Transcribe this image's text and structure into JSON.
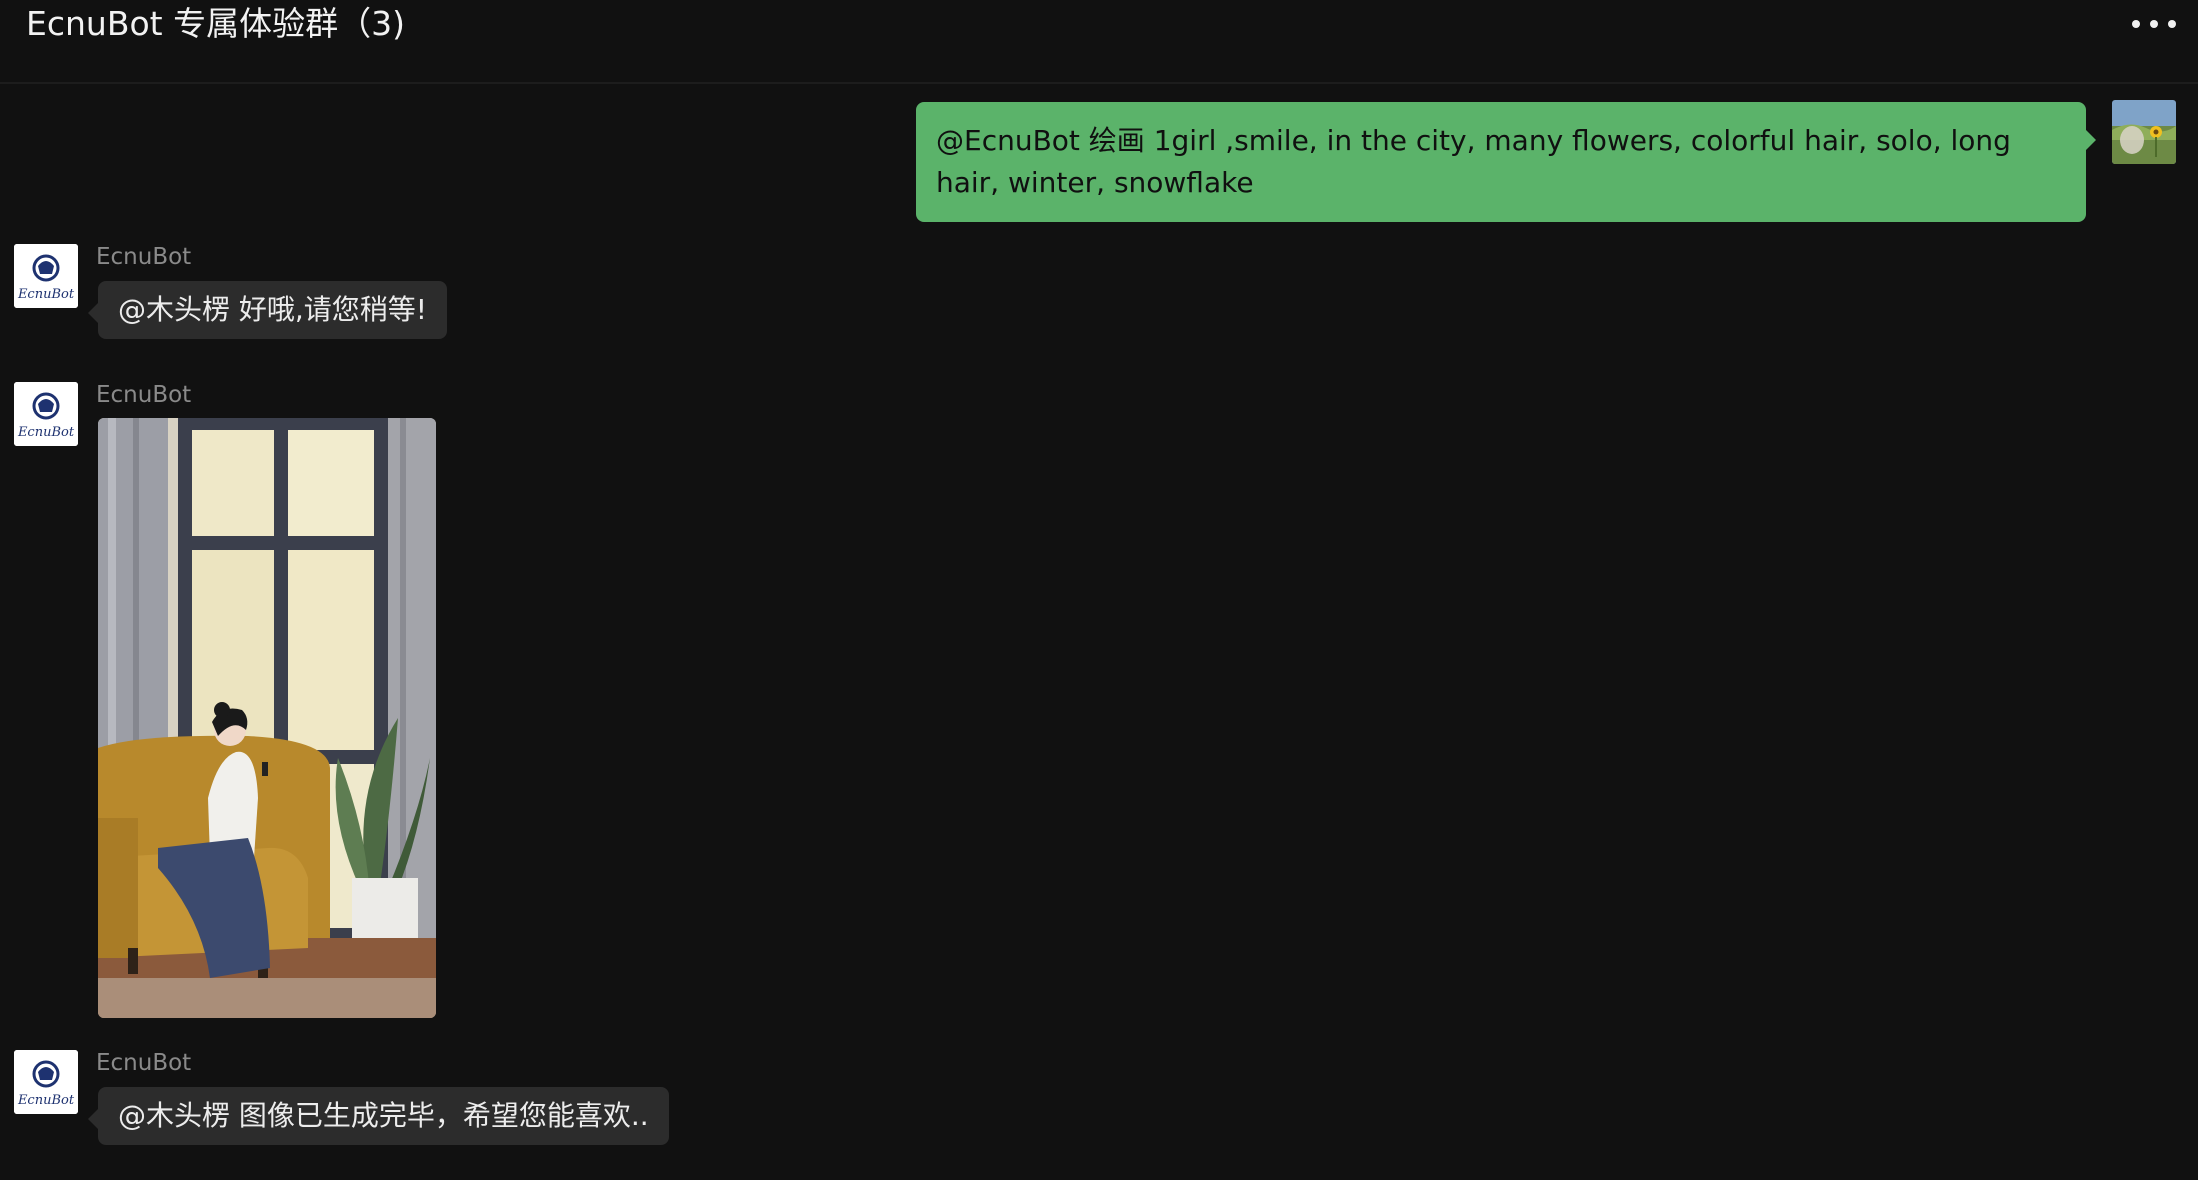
{
  "header": {
    "title": "EcnuBot 专属体验群（3)",
    "more_icon": "more-dots-icon"
  },
  "messages": [
    {
      "direction": "outgoing",
      "text": "@EcnuBot 绘画 1girl ,smile, in the city, many flowers, colorful hair, solo, long hair, winter, snowflake",
      "avatar": "user-avatar-sunflower"
    },
    {
      "direction": "incoming",
      "sender": "EcnuBot",
      "text": "@木头楞  好哦,请您稍等!",
      "avatar_label": "EcnuBot"
    },
    {
      "direction": "incoming",
      "sender": "EcnuBot",
      "type": "image",
      "image_desc": "generated-illustration",
      "avatar_label": "EcnuBot"
    },
    {
      "direction": "incoming",
      "sender": "EcnuBot",
      "text": "@木头楞 图像已生成完毕，希望您能喜欢..",
      "avatar_label": "EcnuBot"
    }
  ],
  "colors": {
    "background": "#111111",
    "outgoing_bubble": "#5bb36a",
    "incoming_bubble": "#2c2c2c",
    "sender_name": "#8a8a8a"
  }
}
